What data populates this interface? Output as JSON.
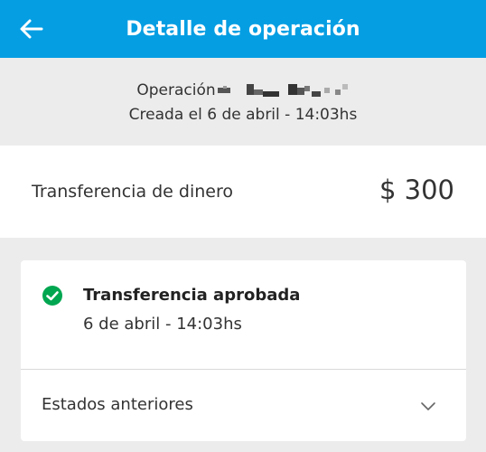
{
  "appbar": {
    "title": "Detalle de operación",
    "back_icon": "arrow-left-icon"
  },
  "operation": {
    "id_label": "Operación",
    "id_value": "redacted",
    "created": "Creada el 6 de abril - 14:03hs"
  },
  "summary": {
    "label": "Transferencia de dinero",
    "amount": "$ 300"
  },
  "status": {
    "icon": "check-circle-icon",
    "color": "#00a650",
    "title": "Transferencia aprobada",
    "date": "6 de abril - 14:03hs",
    "previous_label": "Estados anteriores",
    "expand_icon": "chevron-down-icon"
  },
  "colors": {
    "appbar": "#059ee3",
    "background": "#ececec",
    "card": "#ffffff"
  }
}
